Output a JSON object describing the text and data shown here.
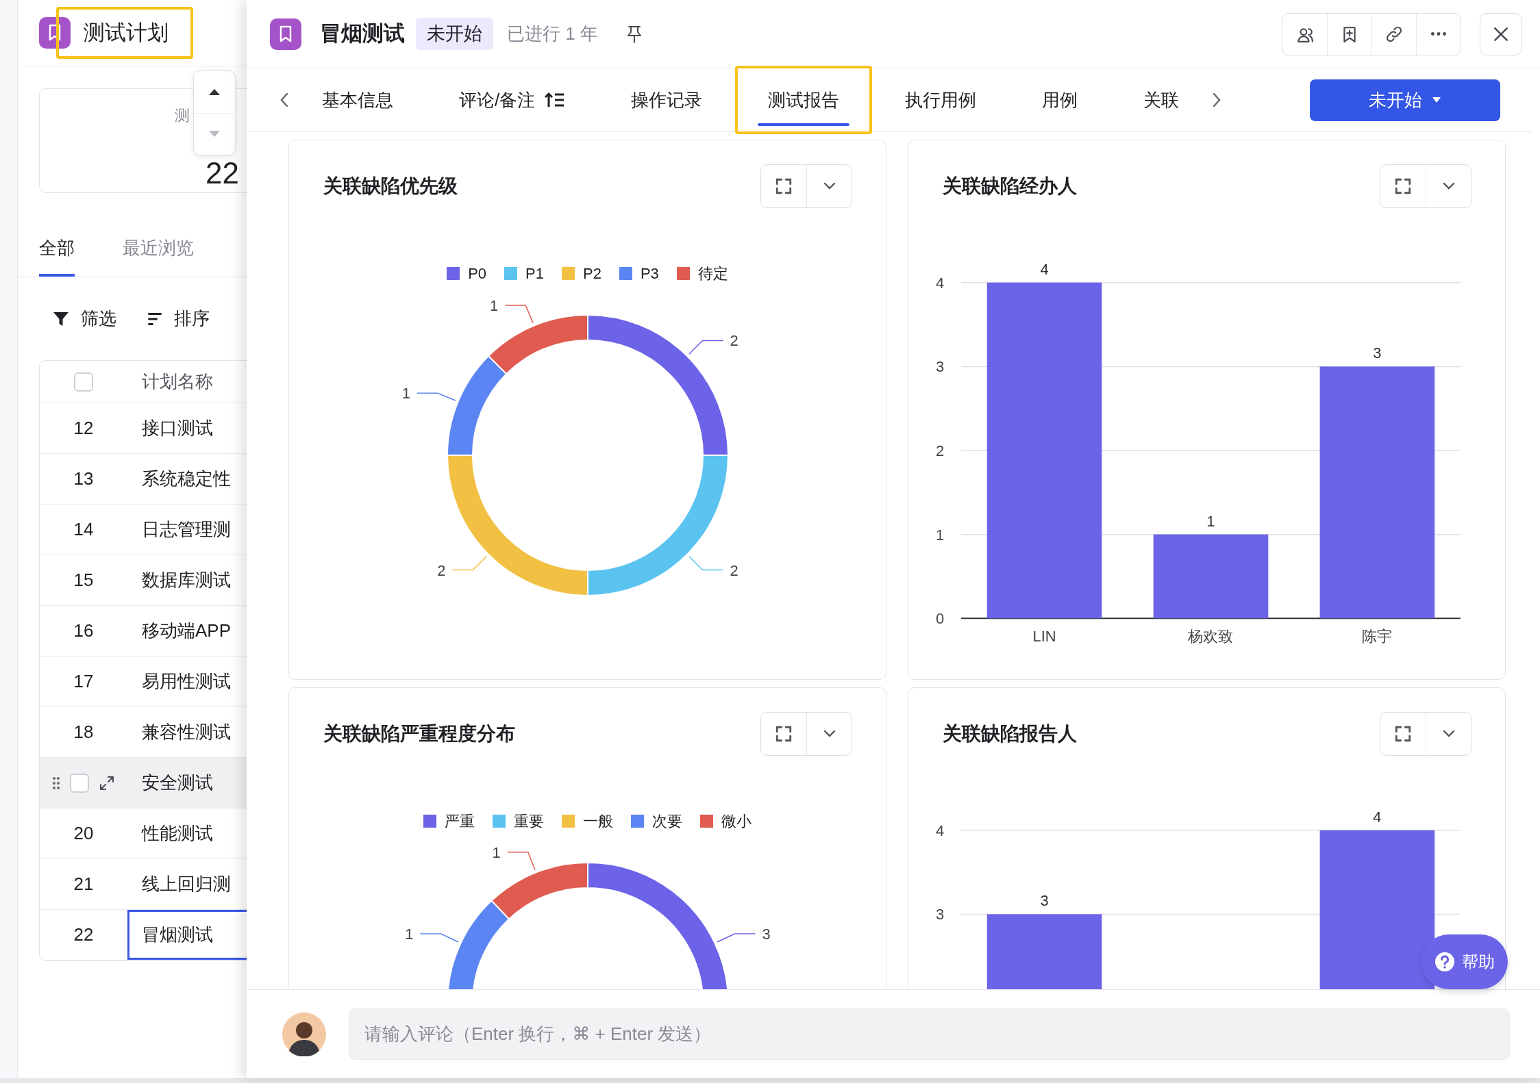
{
  "sidebar": {
    "title": "测试计划",
    "title_highlighted": true,
    "stat": {
      "label": "测",
      "value": "22"
    },
    "stepper": [
      {
        "kind": "up",
        "disabled": false
      },
      {
        "kind": "down",
        "disabled": true
      }
    ],
    "tabs": [
      {
        "label": "全部",
        "selected": true
      },
      {
        "label": "最近浏览",
        "selected": false
      }
    ],
    "tools": [
      {
        "label": "筛选",
        "kind": "filter"
      },
      {
        "label": "排序",
        "kind": "sort"
      }
    ],
    "table": {
      "header_checked": false,
      "columns": [
        "计划名称"
      ],
      "rows": [
        {
          "index": "12",
          "name": "接口测试",
          "hovered": false,
          "selected": false
        },
        {
          "index": "13",
          "name": "系统稳定性",
          "hovered": false,
          "selected": false
        },
        {
          "index": "14",
          "name": "日志管理测",
          "hovered": false,
          "selected": false
        },
        {
          "index": "15",
          "name": "数据库测试",
          "hovered": false,
          "selected": false
        },
        {
          "index": "16",
          "name": "移动端APP",
          "hovered": false,
          "selected": false
        },
        {
          "index": "17",
          "name": "易用性测试",
          "hovered": false,
          "selected": false
        },
        {
          "index": "18",
          "name": "兼容性测试",
          "hovered": false,
          "selected": false
        },
        {
          "name": "安全测试",
          "hovered": true,
          "selected": false,
          "checked": false
        },
        {
          "index": "20",
          "name": "性能测试",
          "hovered": false,
          "selected": false
        },
        {
          "index": "21",
          "name": "线上回归测",
          "hovered": false,
          "selected": false
        },
        {
          "index": "22",
          "name": "冒烟测试",
          "hovered": false,
          "selected": true
        }
      ]
    }
  },
  "drawer": {
    "title": "冒烟测试",
    "status_badge": "未开始",
    "elapsed": "已进行 1 年",
    "tabs": [
      {
        "label": "基本信息",
        "kind": "plain",
        "selected": false,
        "highlighted": false
      },
      {
        "label": "评论/备注",
        "kind": "sort",
        "selected": false,
        "highlighted": false
      },
      {
        "label": "操作记录",
        "kind": "plain",
        "selected": false,
        "highlighted": false
      },
      {
        "label": "测试报告",
        "kind": "plain",
        "selected": true,
        "highlighted": true
      },
      {
        "label": "执行用例",
        "kind": "plain",
        "selected": false,
        "highlighted": false
      },
      {
        "label": "用例",
        "kind": "plain",
        "selected": false,
        "highlighted": false
      },
      {
        "label": "关联",
        "kind": "plain",
        "selected": false,
        "highlighted": false
      }
    ],
    "status_button": "未开始",
    "reports": [
      {
        "title": "关联缺陷优先级",
        "chart_data": {
          "type": "donut",
          "categories": [
            "P0",
            "P1",
            "P2",
            "P3",
            "待定"
          ],
          "values": [
            2,
            2,
            2,
            1,
            1
          ],
          "colors": [
            "#6c63e9",
            "#5bc3f0",
            "#f2c043",
            "#5b85f2",
            "#e05b50"
          ],
          "data_labels": true
        }
      },
      {
        "title": "关联缺陷经办人",
        "chart_data": {
          "type": "bar",
          "categories": [
            "LIN",
            "杨欢致",
            "陈宇"
          ],
          "series": [
            {
              "color": "#6b63e8",
              "values": [
                4,
                1,
                3
              ]
            }
          ],
          "grid": true,
          "ylim": [
            0,
            4
          ],
          "yticks": [
            0,
            1,
            2,
            3,
            4
          ],
          "data_labels": true
        }
      },
      {
        "title": "关联缺陷严重程度分布",
        "chart_data": {
          "type": "donut",
          "categories": [
            "严重",
            "重要",
            "一般",
            "次要",
            "微小"
          ],
          "values": [
            3,
            null,
            null,
            1,
            1
          ],
          "colors": [
            "#6c63e9",
            "#5bc3f0",
            "#f2c043",
            "#5b85f2",
            "#e05b50"
          ],
          "data_labels": true
        }
      },
      {
        "title": "关联缺陷报告人",
        "chart_data": {
          "type": "bar",
          "series": [
            {
              "color": "#6b63e8",
              "values": [
                3,
                null,
                4
              ]
            }
          ],
          "grid": true,
          "ylim": [
            0,
            4
          ],
          "yticks": [
            3,
            4
          ],
          "data_labels": true
        }
      }
    ],
    "comment": {
      "placeholder": "请输入评论（Enter 换行，⌘ + Enter 发送）"
    },
    "help_button": "帮助"
  }
}
